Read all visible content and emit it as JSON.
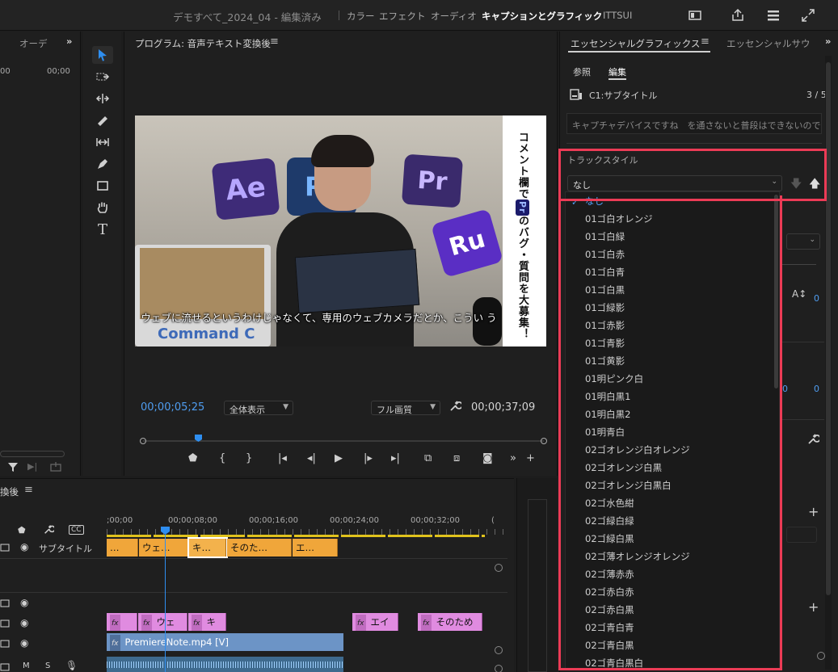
{
  "topbar": {
    "project_title": "デモすべて_2024_04 - 編集済み",
    "workspaces": [
      "カラー",
      "エフェクト",
      "オーディオ",
      "キャプションとグラフィック",
      "ITTSUI"
    ],
    "active_workspace": "キャプションとグラフィック"
  },
  "left_panel": {
    "tab": "オーデ",
    "tc_left": "00",
    "tc_right": "00;00"
  },
  "program": {
    "title": "プログラム: 音声テキスト変換後",
    "current_tc": "00;00;05;25",
    "zoom": "全体表示",
    "quality": "フル画質",
    "duration_tc": "00;00;37;09",
    "video": {
      "pillows": [
        "Ae",
        "Ps",
        "Pr",
        "Ru"
      ],
      "vertical_text_1": "コメント欄で",
      "badge": "Pr",
      "vertical_text_2": "のバグ・質問を大募集！",
      "caption": "ウェブに流せるというわけじゃなくて、専用のウェブカメラだとか、こうい う",
      "laptop_text": "Command C"
    }
  },
  "timeline": {
    "title": "換後",
    "ruler": [
      ";00;00",
      "00;00;08;00",
      "00;00;16;00",
      "00;00;24;00",
      "00;00;32;00"
    ],
    "track_name": "サブタイトル",
    "caption_clips": [
      "…",
      "ウェ…",
      "キ…",
      "そのた…",
      "エ…"
    ],
    "graphic_clips": [
      "",
      "ウェ",
      "キ",
      "エイ",
      "そのため"
    ],
    "video_clip": "PremiereNote.mp4 [V]",
    "audio_labels": [
      "M",
      "S"
    ]
  },
  "essential_graphics": {
    "tab_active": "エッセンシャルグラフィックス",
    "tab_other": "エッセンシャルサウ",
    "sub_tabs": [
      "参照",
      "編集"
    ],
    "active_sub_tab": "編集",
    "caption_track": "C1:サブタイトル",
    "counter": "3 / 5",
    "caption_text": "キャプチャデバイスですね　を通さないと普段はできないので",
    "track_style_label": "トラックスタイル",
    "track_style_value": "なし",
    "num_values": [
      "0",
      "0",
      "0"
    ]
  },
  "dropdown": {
    "items": [
      "なし",
      "01ゴ白オレンジ",
      "01ゴ白緑",
      "01ゴ白赤",
      "01ゴ白青",
      "01ゴ白黒",
      "01ゴ緑影",
      "01ゴ赤影",
      "01ゴ青影",
      "01ゴ黄影",
      "01明ピンク白",
      "01明白黒1",
      "01明白黒2",
      "01明青白",
      "02ゴオレンジ白オレンジ",
      "02ゴオレンジ白黒",
      "02ゴオレンジ白黒白",
      "02ゴ水色紺",
      "02ゴ緑白緑",
      "02ゴ緑白黒",
      "02ゴ薄オレンジオレンジ",
      "02ゴ薄赤赤",
      "02ゴ赤白赤",
      "02ゴ赤白黒",
      "02ゴ青白青",
      "02ゴ青白黒",
      "02ゴ青白黒白"
    ],
    "selected": "なし"
  },
  "colors": {
    "accent_blue": "#4f9df0",
    "highlight_red": "#ec3b56",
    "caption_orange": "#f0a63a",
    "graphic_pink": "#e08be0",
    "video_blue": "#6c94c6"
  }
}
